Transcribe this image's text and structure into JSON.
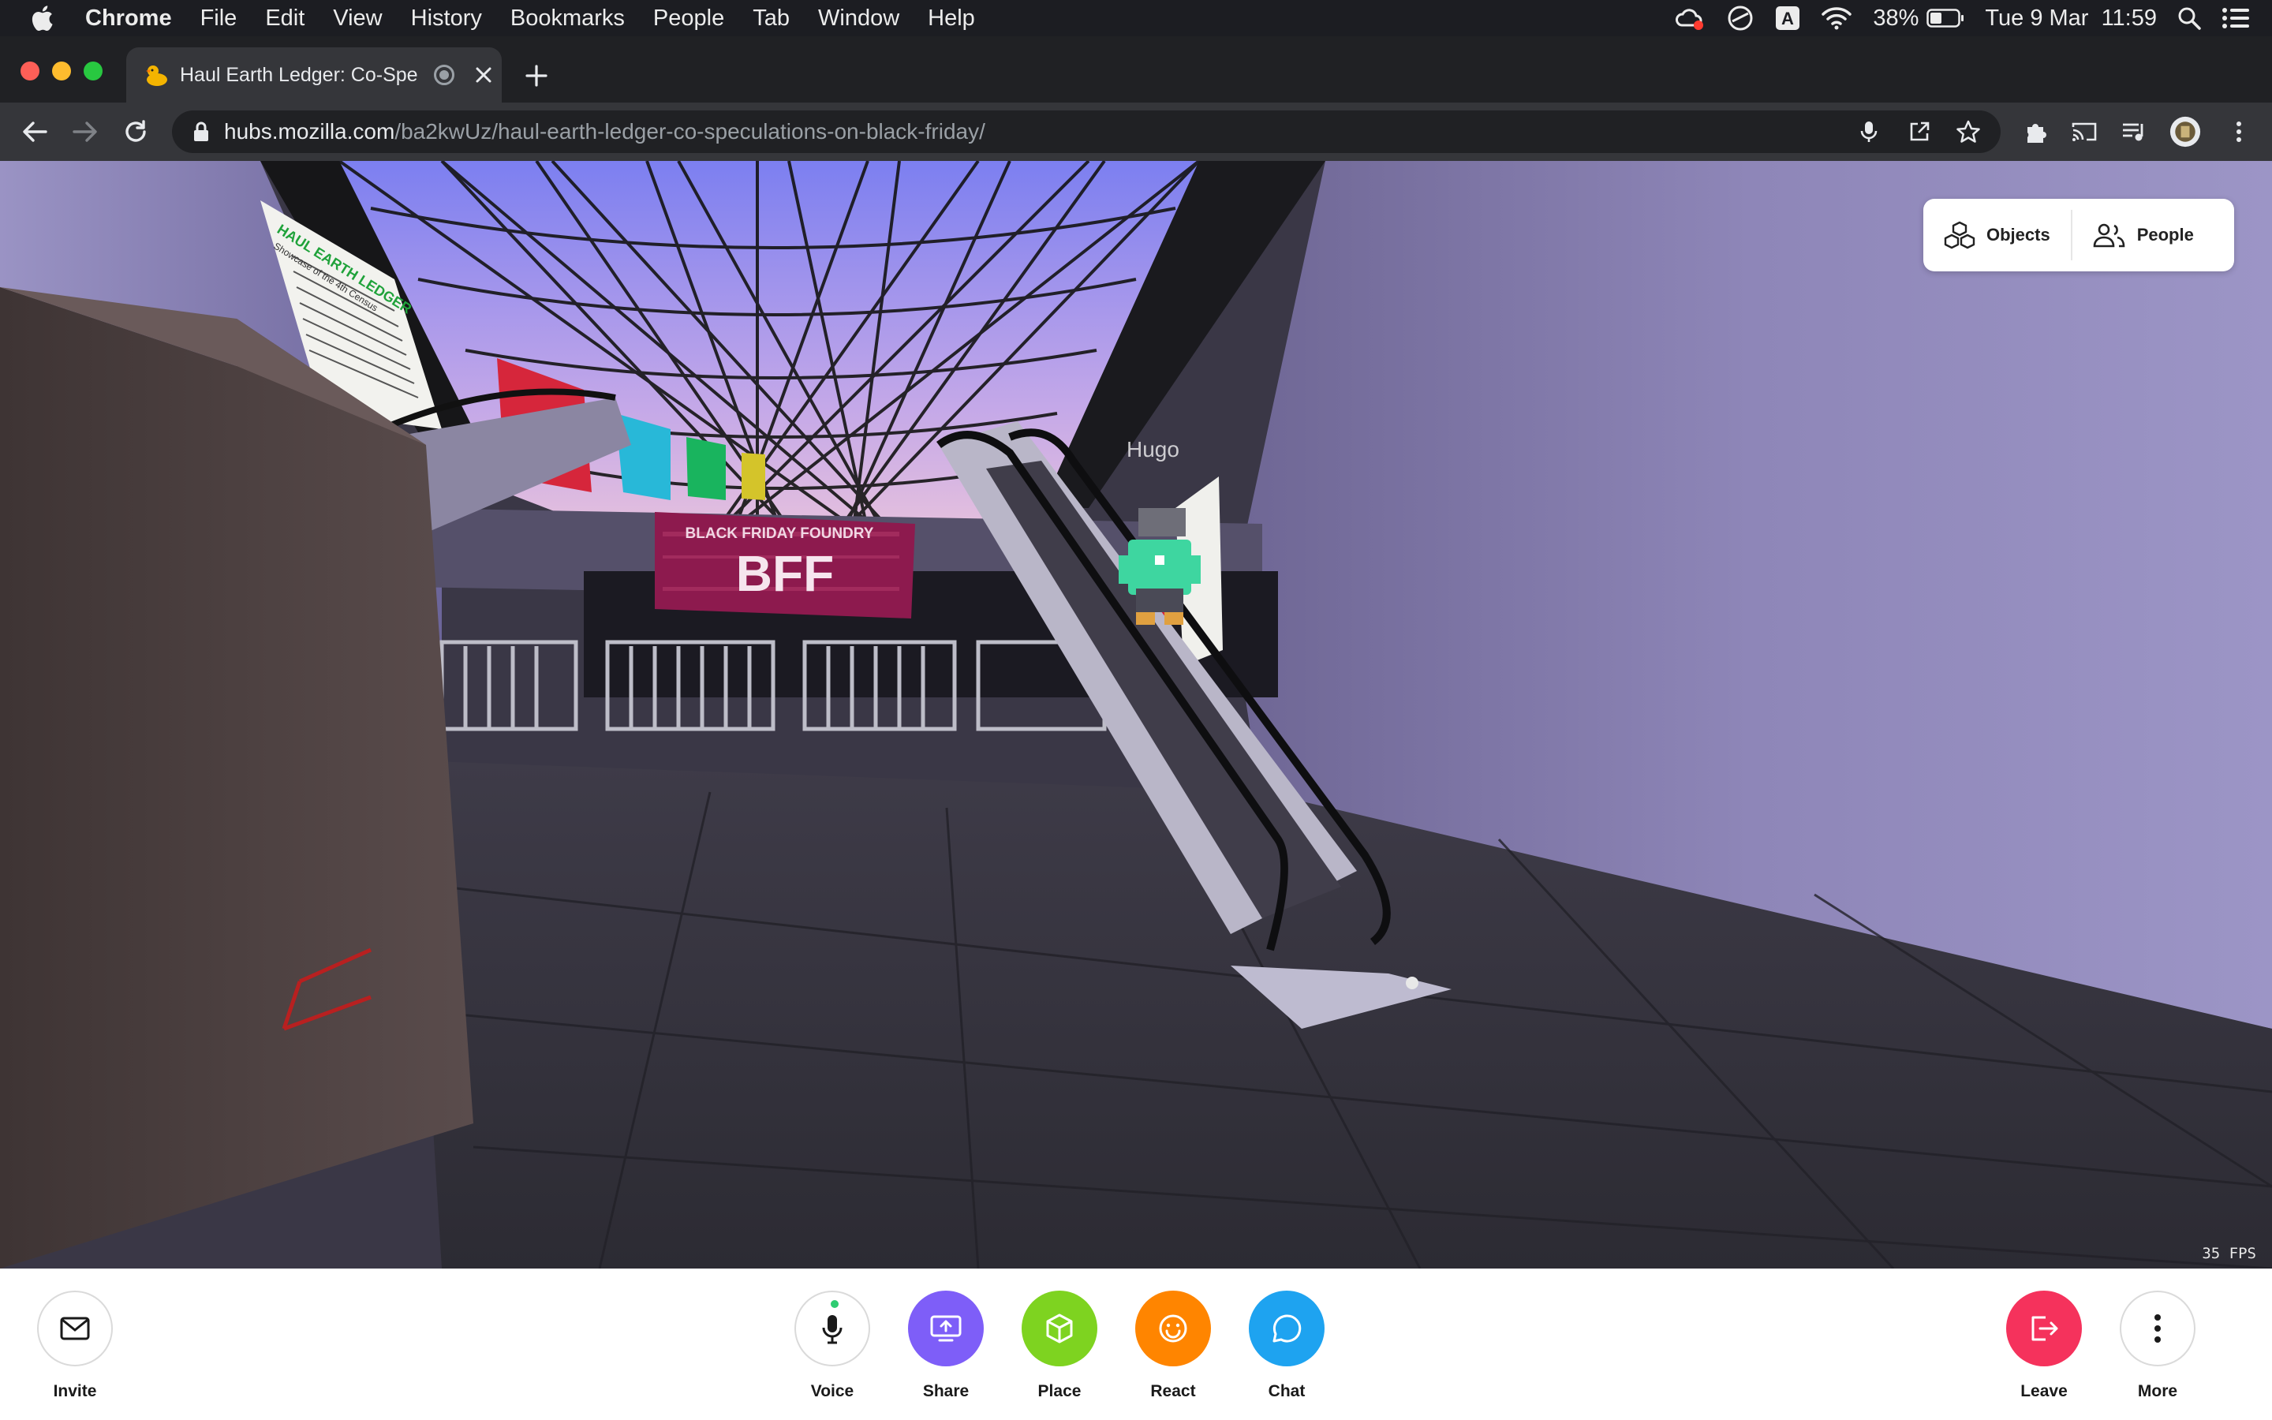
{
  "menubar": {
    "app_name": "Chrome",
    "items": [
      "File",
      "Edit",
      "View",
      "History",
      "Bookmarks",
      "People",
      "Tab",
      "Window",
      "Help"
    ],
    "battery": "38%",
    "clock": "Tue 9 Mar  11:59",
    "input_source": "A"
  },
  "tab": {
    "title": "Haul Earth Ledger: Co-Spe"
  },
  "omnibox": {
    "host": "hubs.mozilla.com",
    "path": "/ba2kwUz/haul-earth-ledger-co-speculations-on-black-friday/"
  },
  "scene": {
    "avatar_name": "Hugo",
    "fps": "35 FPS",
    "banner_line1": "BLACK FRIDAY FOUNDRY",
    "banner_big": "BFF",
    "poster_title": "HAUL EARTH LEDGER",
    "poster_subtitle": "Showcase of the 4th Census"
  },
  "panel_toggle": {
    "objects_label": "Objects",
    "people_label": "People"
  },
  "bottombar": {
    "invite_label": "Invite",
    "voice_label": "Voice",
    "share_label": "Share",
    "place_label": "Place",
    "react_label": "React",
    "chat_label": "Chat",
    "leave_label": "Leave",
    "more_label": "More"
  },
  "colors": {
    "share": "#7e5ef8",
    "place": "#7ed320",
    "react": "#ff8500",
    "chat": "#1ea3f0",
    "leave": "#f5325c"
  }
}
